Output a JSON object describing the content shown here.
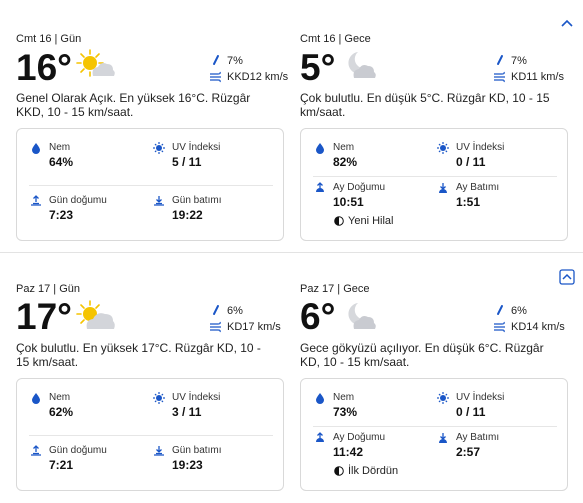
{
  "days": [
    {
      "day": {
        "period": "Cmt 16 | Gün",
        "temp": "16°",
        "icon": "sun-cloud-icon",
        "precip": "7%",
        "wind": "KKD12 km/s",
        "summary": "Genel Olarak Açık. En yüksek 16°C. Rüzgâr KKD, 10 - 15 km/saat.",
        "d1_label": "Nem",
        "d1_value": "64%",
        "d2_label": "UV İndeksi",
        "d2_value": "5 / 11",
        "d3_label": "Gün doğumu",
        "d3_value": "7:23",
        "d4_label": "Gün batımı",
        "d4_value": "19:22"
      },
      "night": {
        "period": "Cmt 16 | Gece",
        "temp": "5°",
        "icon": "moon-cloud-icon",
        "precip": "7%",
        "wind": "KD11 km/s",
        "summary": "Çok bulutlu. En düşük 5°C. Rüzgâr KD, 10 - 15 km/saat.",
        "d1_label": "Nem",
        "d1_value": "82%",
        "d2_label": "UV İndeksi",
        "d2_value": "0 / 11",
        "d3_label": "Ay Doğumu",
        "d3_value": "10:51",
        "d4_label": "Ay Batımı",
        "d4_value": "1:51",
        "moon_phase": "Yeni Hilal"
      }
    },
    {
      "day": {
        "period": "Paz 17 | Gün",
        "temp": "17°",
        "icon": "sun-cloud-icon",
        "precip": "6%",
        "wind": "KD17 km/s",
        "summary": "Çok bulutlu. En yüksek 17°C. Rüzgâr KD, 10 - 15 km/saat.",
        "d1_label": "Nem",
        "d1_value": "62%",
        "d2_label": "UV İndeksi",
        "d2_value": "3 / 11",
        "d3_label": "Gün doğumu",
        "d3_value": "7:21",
        "d4_label": "Gün batımı",
        "d4_value": "19:23"
      },
      "night": {
        "period": "Paz 17 | Gece",
        "temp": "6°",
        "icon": "moon-cloud-icon",
        "precip": "6%",
        "wind": "KD14 km/s",
        "summary": "Gece gökyüzü açılıyor. En düşük 6°C. Rüzgâr KD, 10 - 15 km/saat.",
        "d1_label": "Nem",
        "d1_value": "73%",
        "d2_label": "UV İndeksi",
        "d2_value": "0 / 11",
        "d3_label": "Ay Doğumu",
        "d3_value": "11:42",
        "d4_label": "Ay Batımı",
        "d4_value": "2:57",
        "moon_phase": "İlk Dördün"
      }
    }
  ],
  "colors": {
    "accent": "#1a56c7",
    "sun": "#f5c400",
    "cloud": "#c9cbd1",
    "border": "#d9d9d9"
  }
}
